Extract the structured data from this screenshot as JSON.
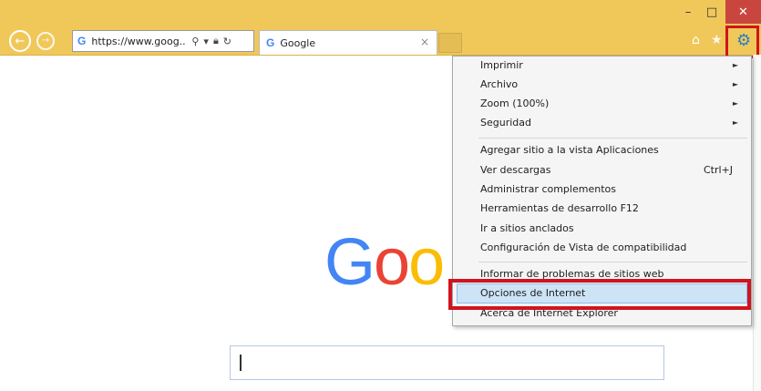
{
  "window": {
    "minimize_glyph": "–",
    "maximize_glyph": "□",
    "close_glyph": "✕"
  },
  "address_bar": {
    "url": "https://www.goog...",
    "site_icon_letter": "G"
  },
  "tab": {
    "title": "Google",
    "icon_letter": "G",
    "close_glyph": "×"
  },
  "toolbar": {
    "home_icon": "home-icon",
    "favorites_icon": "star-icon",
    "tools_icon": "gear-icon"
  },
  "tools_menu": {
    "group1": [
      {
        "label": "Imprimir",
        "has_submenu": true
      },
      {
        "label": "Archivo",
        "has_submenu": true
      },
      {
        "label": "Zoom (100%)",
        "has_submenu": true
      },
      {
        "label": "Seguridad",
        "has_submenu": true
      }
    ],
    "group2": [
      {
        "label": "Agregar sitio a la vista Aplicaciones"
      },
      {
        "label": "Ver descargas",
        "shortcut": "Ctrl+J"
      },
      {
        "label": "Administrar complementos"
      },
      {
        "label": "Herramientas de desarrollo F12"
      },
      {
        "label": "Ir a sitios anclados"
      },
      {
        "label": "Configuración de Vista de compatibilidad"
      }
    ],
    "group3": [
      {
        "label": "Informar de problemas de sitios web"
      },
      {
        "label": "Opciones de Internet",
        "selected": true
      },
      {
        "label": "Acerca de Internet Explorer"
      }
    ],
    "submenu_arrow": "►"
  },
  "page": {
    "logo_letters": [
      "G",
      "o",
      "o"
    ]
  },
  "colors": {
    "highlight": "#d0141e",
    "titlebar": "#f0c85a",
    "selection": "#cde4f7"
  }
}
